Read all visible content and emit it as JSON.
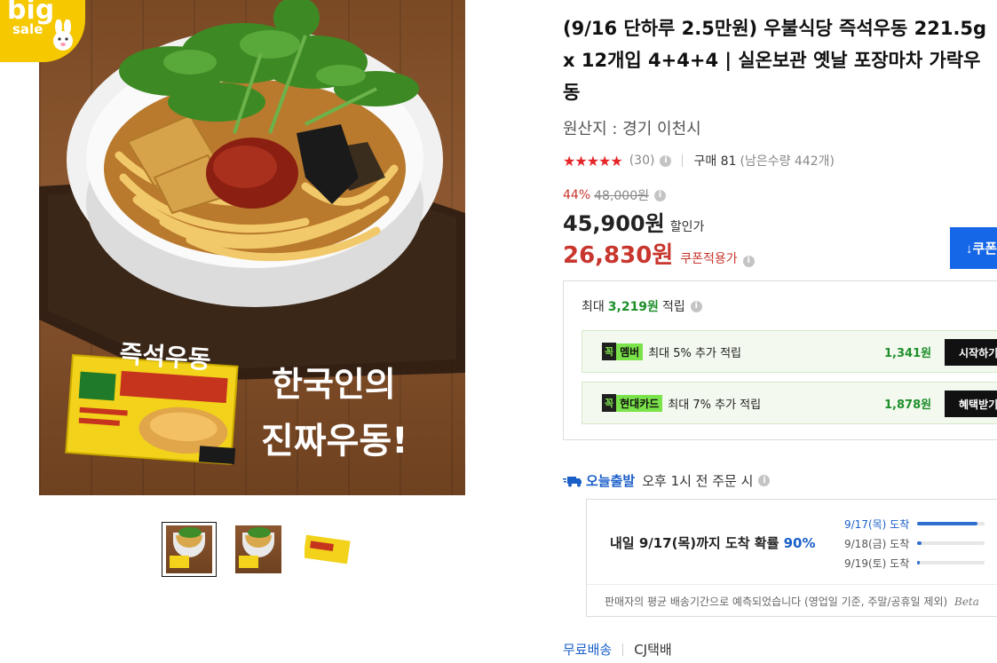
{
  "badge": {
    "line1": "big",
    "line2": "sale"
  },
  "hero": {
    "overlay_line1": "한국인의",
    "overlay_line2": "진짜우동!",
    "package_name": "즉석우동"
  },
  "product": {
    "title": "(9/16 단하루 2.5만원) 우불식당 즉석우동 221.5g x 12개입 4+4+4 | 실온보관 옛날 포장마차 가락우동",
    "origin": "원산지 : 경기 이천시",
    "rating_stars": "★★★★★",
    "rating_value": 4.5,
    "review_count": "(30)",
    "sold": "구매 81",
    "stock": "(남은수량 442개)",
    "discount_rate": "44%",
    "original_price": "48,000원",
    "sale_price": "45,900원",
    "sale_label": "할인가",
    "coupon_price": "26,830원",
    "coupon_label": "쿠폰적용가",
    "coupon_button": "↓쿠폰"
  },
  "points": {
    "head_prefix": "최대",
    "head_amount": "3,219원",
    "head_suffix": "적립",
    "rewards": [
      {
        "brand_k": "꼭",
        "brand_name": "멤버",
        "desc": "최대 5% 추가 적립",
        "amount": "1,341원",
        "button": "시작하기"
      },
      {
        "brand_k": "꼭",
        "brand_name": "현대카드",
        "desc": "최대 7% 추가 적립",
        "amount": "1,878원",
        "button": "혜택받기"
      }
    ]
  },
  "delivery": {
    "today_label": "오늘출발",
    "today_condition": "오후 1시 전 주문 시",
    "main_prefix": "내일 9/17(목)까지 도착 확률",
    "main_percent": "90%",
    "probabilities": [
      {
        "date": "9/17(목) 도착",
        "value": 0.9
      },
      {
        "date": "9/18(금) 도착",
        "value": 0.06
      },
      {
        "date": "9/19(토) 도착",
        "value": 0.04
      }
    ],
    "note": "판매자의 평균 배송기간으로 예측되었습니다 (영업일 기준, 주말/공휴일 제외)",
    "beta": "Beta"
  },
  "shipping": {
    "fee": "무료배송",
    "carrier": "CJ택배"
  },
  "colors": {
    "accent_red": "#c8362d",
    "accent_blue": "#1667e8",
    "point_green": "#1e8f2b",
    "badge_yellow": "#f5c800"
  }
}
